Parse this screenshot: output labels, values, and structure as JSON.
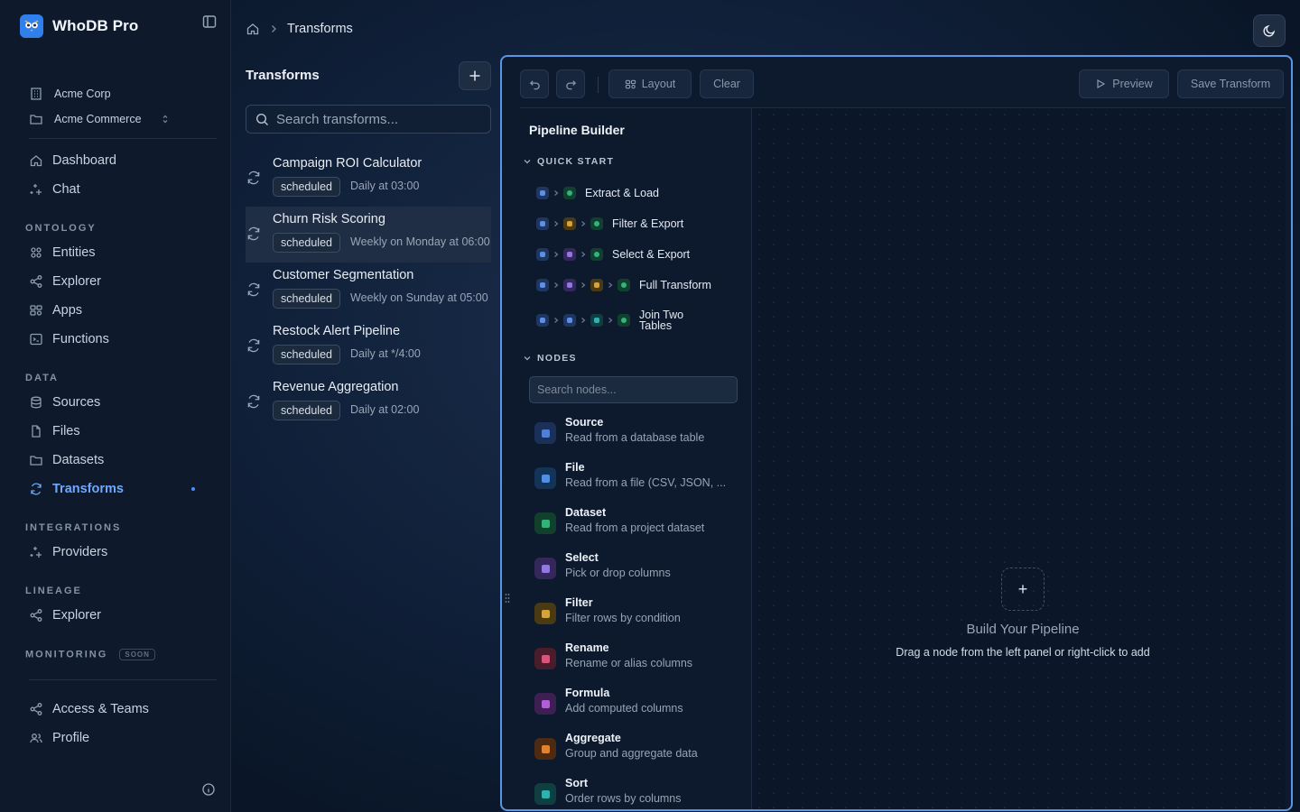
{
  "app": {
    "name": "WhoDB Pro"
  },
  "sidebar": {
    "org": "Acme Corp",
    "database": "Acme Commerce",
    "main_items": [
      {
        "label": "Dashboard",
        "icon": "home-icon"
      },
      {
        "label": "Chat",
        "icon": "sparkles-icon"
      }
    ],
    "sections": {
      "ontology": {
        "label": "ONTOLOGY",
        "items": [
          {
            "label": "Entities",
            "icon": "grid-icon"
          },
          {
            "label": "Explorer",
            "icon": "share-icon"
          },
          {
            "label": "Apps",
            "icon": "apps-icon"
          },
          {
            "label": "Functions",
            "icon": "terminal-icon"
          }
        ]
      },
      "data": {
        "label": "DATA",
        "items": [
          {
            "label": "Sources",
            "icon": "database-icon"
          },
          {
            "label": "Files",
            "icon": "file-icon"
          },
          {
            "label": "Datasets",
            "icon": "folder-icon"
          },
          {
            "label": "Transforms",
            "icon": "refresh-icon",
            "active": true
          }
        ]
      },
      "integrations": {
        "label": "INTEGRATIONS",
        "items": [
          {
            "label": "Providers",
            "icon": "sparkles-icon"
          }
        ]
      },
      "lineage": {
        "label": "LINEAGE",
        "items": [
          {
            "label": "Explorer",
            "icon": "share-icon"
          }
        ]
      },
      "monitoring": {
        "label": "MONITORING",
        "badge": "SOON"
      }
    },
    "bottom_items": [
      {
        "label": "Access & Teams",
        "icon": "share-icon"
      },
      {
        "label": "Profile",
        "icon": "users-icon"
      }
    ]
  },
  "breadcrumb": {
    "current": "Transforms"
  },
  "transforms": {
    "title": "Transforms",
    "search_placeholder": "Search transforms...",
    "items": [
      {
        "name": "Campaign ROI Calculator",
        "status": "scheduled",
        "schedule": "Daily at 03:00"
      },
      {
        "name": "Churn Risk Scoring",
        "status": "scheduled",
        "schedule": "Weekly on Monday at 06:00",
        "selected": true
      },
      {
        "name": "Customer Segmentation",
        "status": "scheduled",
        "schedule": "Weekly on Sunday at 05:00"
      },
      {
        "name": "Restock Alert Pipeline",
        "status": "scheduled",
        "schedule": "Daily at */4:00"
      },
      {
        "name": "Revenue Aggregation",
        "status": "scheduled",
        "schedule": "Daily at 02:00"
      }
    ]
  },
  "builder": {
    "toolbar": {
      "layout_label": "Layout",
      "clear_label": "Clear",
      "preview_label": "Preview",
      "save_label": "Save Transform"
    },
    "title": "Pipeline Builder",
    "quick_start_label": "QUICK START",
    "quick_start": [
      {
        "label": "Extract & Load",
        "chips": [
          "blue",
          "green"
        ]
      },
      {
        "label": "Filter & Export",
        "chips": [
          "blue",
          "amber",
          "green"
        ]
      },
      {
        "label": "Select & Export",
        "chips": [
          "blue",
          "purple",
          "green"
        ]
      },
      {
        "label": "Full Transform",
        "chips": [
          "blue",
          "purple",
          "amber",
          "green"
        ]
      },
      {
        "label": "Join Two Tables",
        "chips": [
          "blue",
          "blue",
          "teal",
          "green"
        ]
      }
    ],
    "nodes_label": "NODES",
    "node_search_placeholder": "Search nodes...",
    "nodes": [
      {
        "title": "Source",
        "desc": "Read from a database table",
        "color": "#4f7fd6",
        "bg": "#1b3058"
      },
      {
        "title": "File",
        "desc": "Read from a file (CSV, JSON, ...",
        "color": "#4f8fe6",
        "bg": "#143457"
      },
      {
        "title": "Dataset",
        "desc": "Read from a project dataset",
        "color": "#33b27a",
        "bg": "#11402d"
      },
      {
        "title": "Select",
        "desc": "Pick or drop columns",
        "color": "#9277e0",
        "bg": "#34275c"
      },
      {
        "title": "Filter",
        "desc": "Filter rows by condition",
        "color": "#d4a33b",
        "bg": "#4a3a14"
      },
      {
        "title": "Rename",
        "desc": "Rename or alias columns",
        "color": "#d8557a",
        "bg": "#4a1d2c"
      },
      {
        "title": "Formula",
        "desc": "Add computed columns",
        "color": "#b05fd6",
        "bg": "#3d1f52"
      },
      {
        "title": "Aggregate",
        "desc": "Group and aggregate data",
        "color": "#e0822f",
        "bg": "#4d2b12"
      },
      {
        "title": "Sort",
        "desc": "Order rows by columns",
        "color": "#2fb1b0",
        "bg": "#0f3f40"
      }
    ],
    "empty": {
      "plus": "+",
      "title": "Build Your Pipeline",
      "subtitle": "Drag a node from the left panel or right-click to add"
    }
  }
}
